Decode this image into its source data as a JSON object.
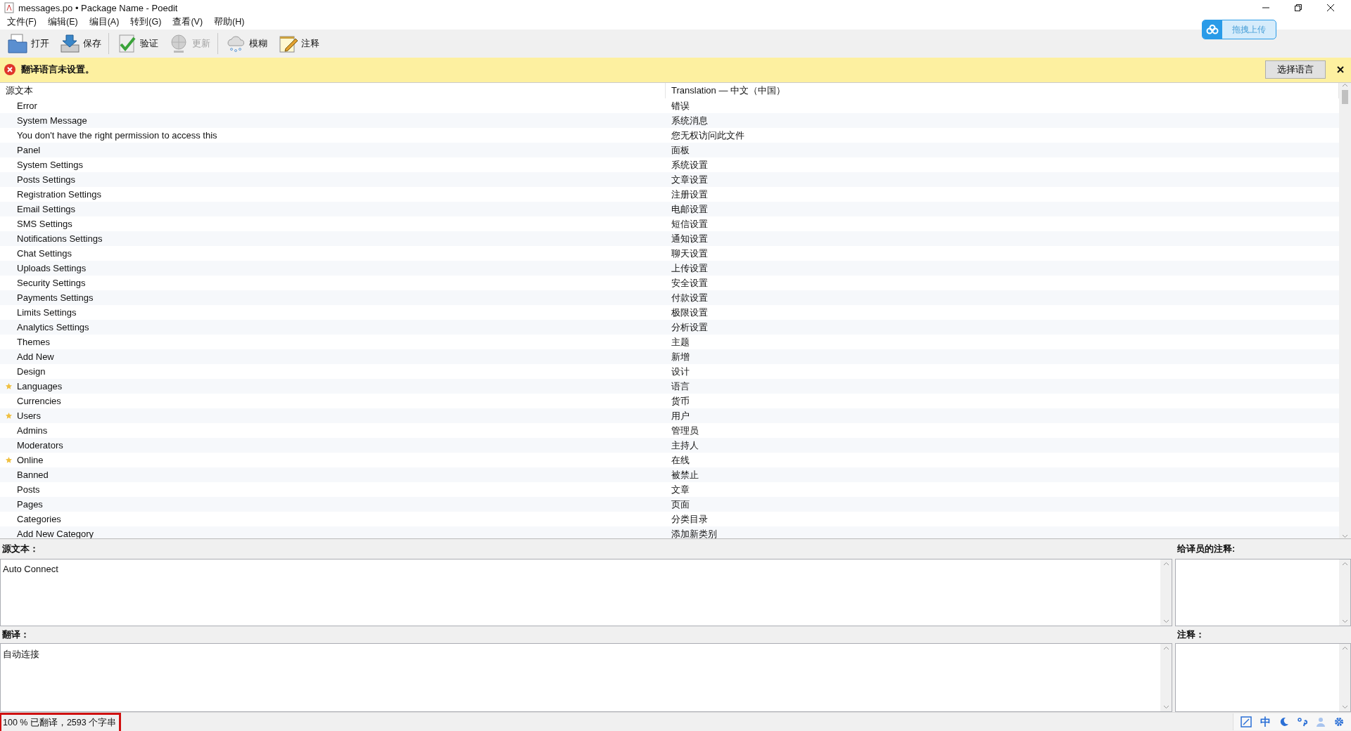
{
  "window": {
    "title": "messages.po • Package Name - Poedit"
  },
  "menu": [
    "文件(F)",
    "编辑(E)",
    "编目(A)",
    "转到(G)",
    "查看(V)",
    "帮助(H)"
  ],
  "toolbar": [
    {
      "kind": "open",
      "label": "打开",
      "disabled": false
    },
    {
      "kind": "save",
      "label": "保存",
      "disabled": false
    },
    {
      "kind": "validate",
      "label": "验证",
      "disabled": false
    },
    {
      "kind": "update",
      "label": "更新",
      "disabled": true
    },
    {
      "kind": "fuzzy",
      "label": "模糊",
      "disabled": false
    },
    {
      "kind": "comment",
      "label": "注释",
      "disabled": false
    }
  ],
  "upload_widget": {
    "label": "拖拽上传"
  },
  "info_bar": {
    "message": "翻译语言未设置。",
    "button": "选择语言"
  },
  "list": {
    "columns": [
      "源文本",
      "Translation — 中文（中国）"
    ],
    "rows": [
      {
        "source": "Error",
        "translation": "错误",
        "starred": false
      },
      {
        "source": "System Message",
        "translation": "系统消息",
        "starred": false
      },
      {
        "source": "You don't have the right permission to access this",
        "translation": "您无权访问此文件",
        "starred": false
      },
      {
        "source": "Panel",
        "translation": "面板",
        "starred": false
      },
      {
        "source": "System Settings",
        "translation": "系统设置",
        "starred": false
      },
      {
        "source": "Posts Settings",
        "translation": "文章设置",
        "starred": false
      },
      {
        "source": "Registration Settings",
        "translation": "注册设置",
        "starred": false
      },
      {
        "source": "Email Settings",
        "translation": "电邮设置",
        "starred": false
      },
      {
        "source": "SMS Settings",
        "translation": "短信设置",
        "starred": false
      },
      {
        "source": "Notifications Settings",
        "translation": "通知设置",
        "starred": false
      },
      {
        "source": "Chat Settings",
        "translation": "聊天设置",
        "starred": false
      },
      {
        "source": "Uploads Settings",
        "translation": "上传设置",
        "starred": false
      },
      {
        "source": "Security Settings",
        "translation": "安全设置",
        "starred": false
      },
      {
        "source": "Payments Settings",
        "translation": "付款设置",
        "starred": false
      },
      {
        "source": "Limits Settings",
        "translation": "极限设置",
        "starred": false
      },
      {
        "source": "Analytics Settings",
        "translation": "分析设置",
        "starred": false
      },
      {
        "source": "Themes",
        "translation": "主题",
        "starred": false
      },
      {
        "source": "Add New",
        "translation": "新增",
        "starred": false
      },
      {
        "source": "Design",
        "translation": "设计",
        "starred": false
      },
      {
        "source": "Languages",
        "translation": "语言",
        "starred": true
      },
      {
        "source": "Currencies",
        "translation": "货币",
        "starred": false
      },
      {
        "source": "Users",
        "translation": "用户",
        "starred": true
      },
      {
        "source": "Admins",
        "translation": "管理员",
        "starred": false
      },
      {
        "source": "Moderators",
        "translation": "主持人",
        "starred": false
      },
      {
        "source": "Online",
        "translation": "在线",
        "starred": true
      },
      {
        "source": "Banned",
        "translation": "被禁止",
        "starred": false
      },
      {
        "source": "Posts",
        "translation": "文章",
        "starred": false
      },
      {
        "source": "Pages",
        "translation": "页面",
        "starred": false
      },
      {
        "source": "Categories",
        "translation": "分类目录",
        "starred": false
      },
      {
        "source": "Add New Category",
        "translation": "添加新类别",
        "starred": false
      }
    ]
  },
  "editor": {
    "source_label": "源文本：",
    "source_text": "Auto Connect",
    "translation_label": "翻译：",
    "translation_text": "自动连接",
    "notes_label": "给译员的注释:",
    "comment_label": "注释："
  },
  "status_bar": {
    "text": "100 % 已翻译，2593 个字串",
    "ime_mode": "中"
  }
}
